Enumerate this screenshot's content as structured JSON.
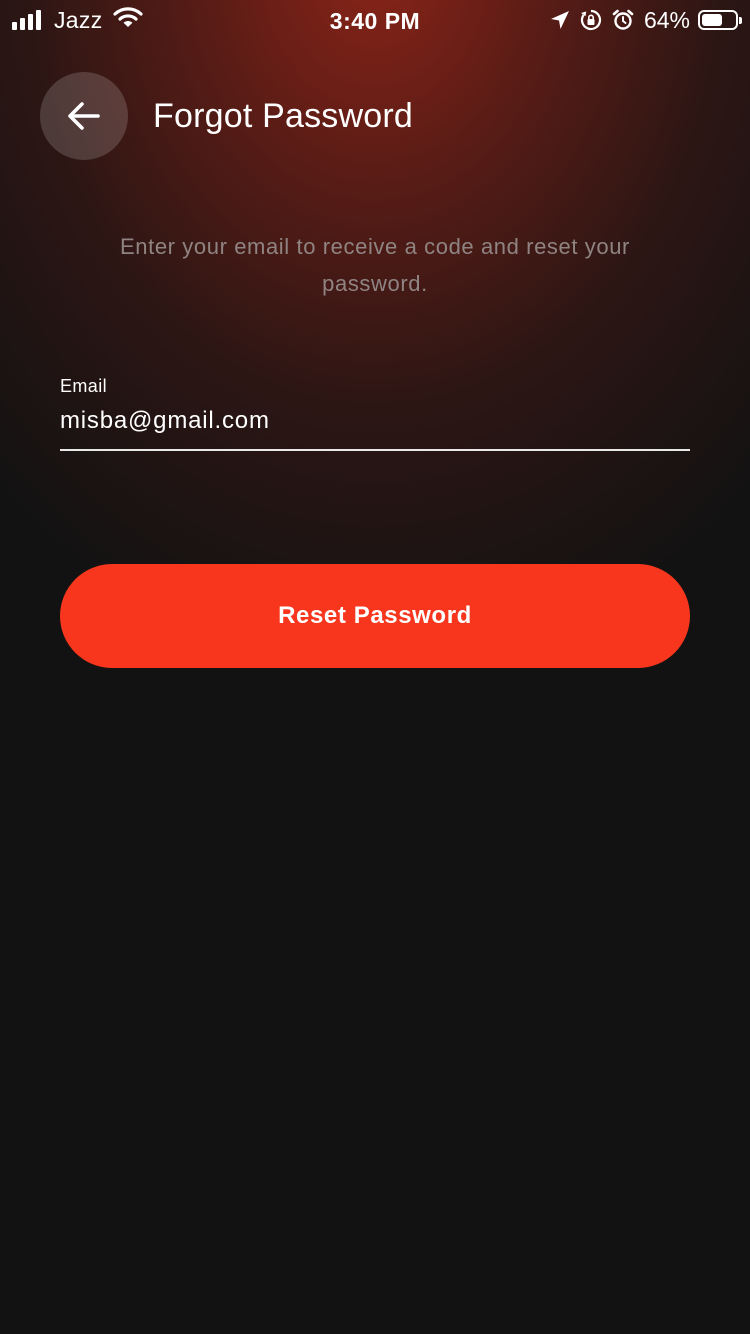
{
  "status_bar": {
    "carrier": "Jazz",
    "time": "3:40 PM",
    "battery_percent": "64%",
    "battery_level": 0.64,
    "icons": [
      "signal-icon",
      "wifi-icon",
      "location-arrow-icon",
      "orientation-lock-icon",
      "alarm-icon",
      "battery-icon"
    ]
  },
  "header": {
    "back_icon": "arrow-left-icon",
    "title": "Forgot Password"
  },
  "instructions": "Enter your email to receive a code and reset your password.",
  "email_field": {
    "label": "Email",
    "value": "misba@gmail.com"
  },
  "reset_button": {
    "label": "Reset Password",
    "color": "#f7361d"
  },
  "colors": {
    "background": "#121212",
    "accent": "#f7361d",
    "muted_text": "#8f8482"
  }
}
